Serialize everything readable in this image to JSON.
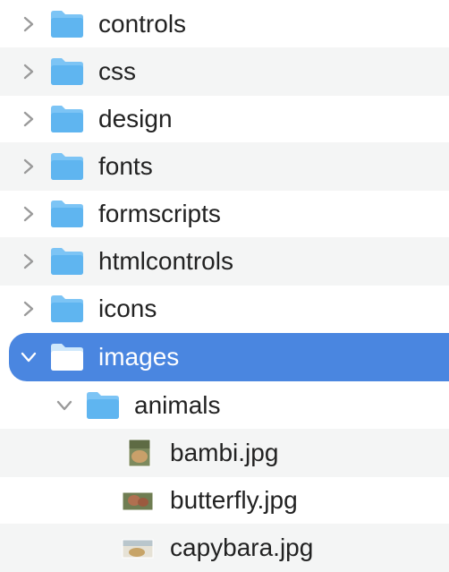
{
  "tree": {
    "rows": [
      {
        "label": "controls",
        "expanded": false,
        "icon": "folder-icon"
      },
      {
        "label": "css",
        "expanded": false,
        "icon": "folder-icon"
      },
      {
        "label": "design",
        "expanded": false,
        "icon": "folder-icon"
      },
      {
        "label": "fonts",
        "expanded": false,
        "icon": "folder-icon"
      },
      {
        "label": "formscripts",
        "expanded": false,
        "icon": "folder-icon"
      },
      {
        "label": "htmlcontrols",
        "expanded": false,
        "icon": "folder-icon"
      },
      {
        "label": "icons",
        "expanded": false,
        "icon": "folder-icon"
      },
      {
        "label": "images",
        "expanded": true,
        "selected": true,
        "icon": "folder-icon"
      },
      {
        "label": "animals",
        "expanded": true,
        "icon": "folder-icon"
      },
      {
        "label": "bambi.jpg",
        "icon": "image-file-icon"
      },
      {
        "label": "butterfly.jpg",
        "icon": "image-file-icon"
      },
      {
        "label": "capybara.jpg",
        "icon": "image-file-icon"
      }
    ]
  },
  "colors": {
    "folder": "#5fb5f0",
    "selection": "#4a86e0",
    "alternate_row": "#f4f5f5",
    "chevron": "#9a9a9a"
  }
}
